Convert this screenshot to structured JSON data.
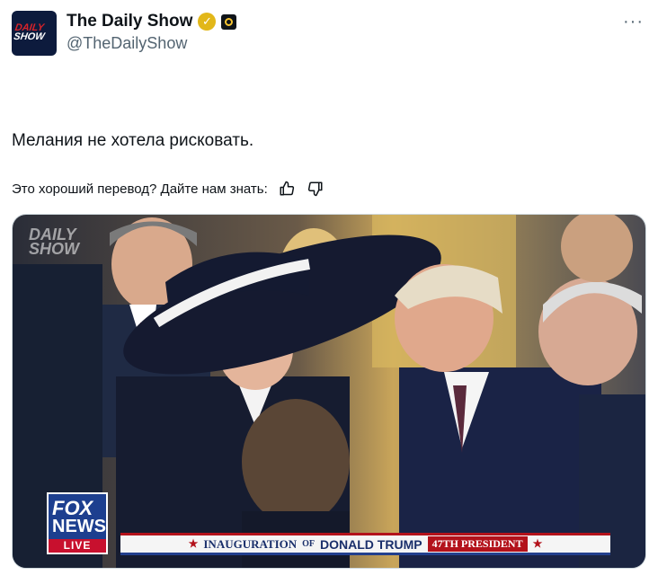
{
  "account": {
    "display_name": "The Daily Show",
    "handle": "@TheDailyShow",
    "avatar_logo_line1": "DAILY",
    "avatar_logo_line2": "SHOW",
    "verified_icon": "check-badge-icon",
    "affiliate_icon": "comedy-central-icon"
  },
  "tweet": {
    "text": "Мелания не хотела рисковать.",
    "translation_prompt": "Это хороший перевод? Дайте нам знать:",
    "more_icon": "more-icon"
  },
  "media": {
    "watermark_line1": "DAILY",
    "watermark_line2": "SHOW",
    "network_logo": {
      "line1": "FOX",
      "line2": "NEWS",
      "line3": "LIVE"
    },
    "ticker": {
      "part1": "INAUGURATION",
      "part2": "OF",
      "part3": "DONALD TRUMP",
      "badge": "47TH PRESIDENT"
    }
  },
  "colors": {
    "text_primary": "#0f1419",
    "text_secondary": "#536471",
    "verified_gold": "#e2b719",
    "fox_blue": "#1d3f8f",
    "fox_red": "#c8102e"
  }
}
